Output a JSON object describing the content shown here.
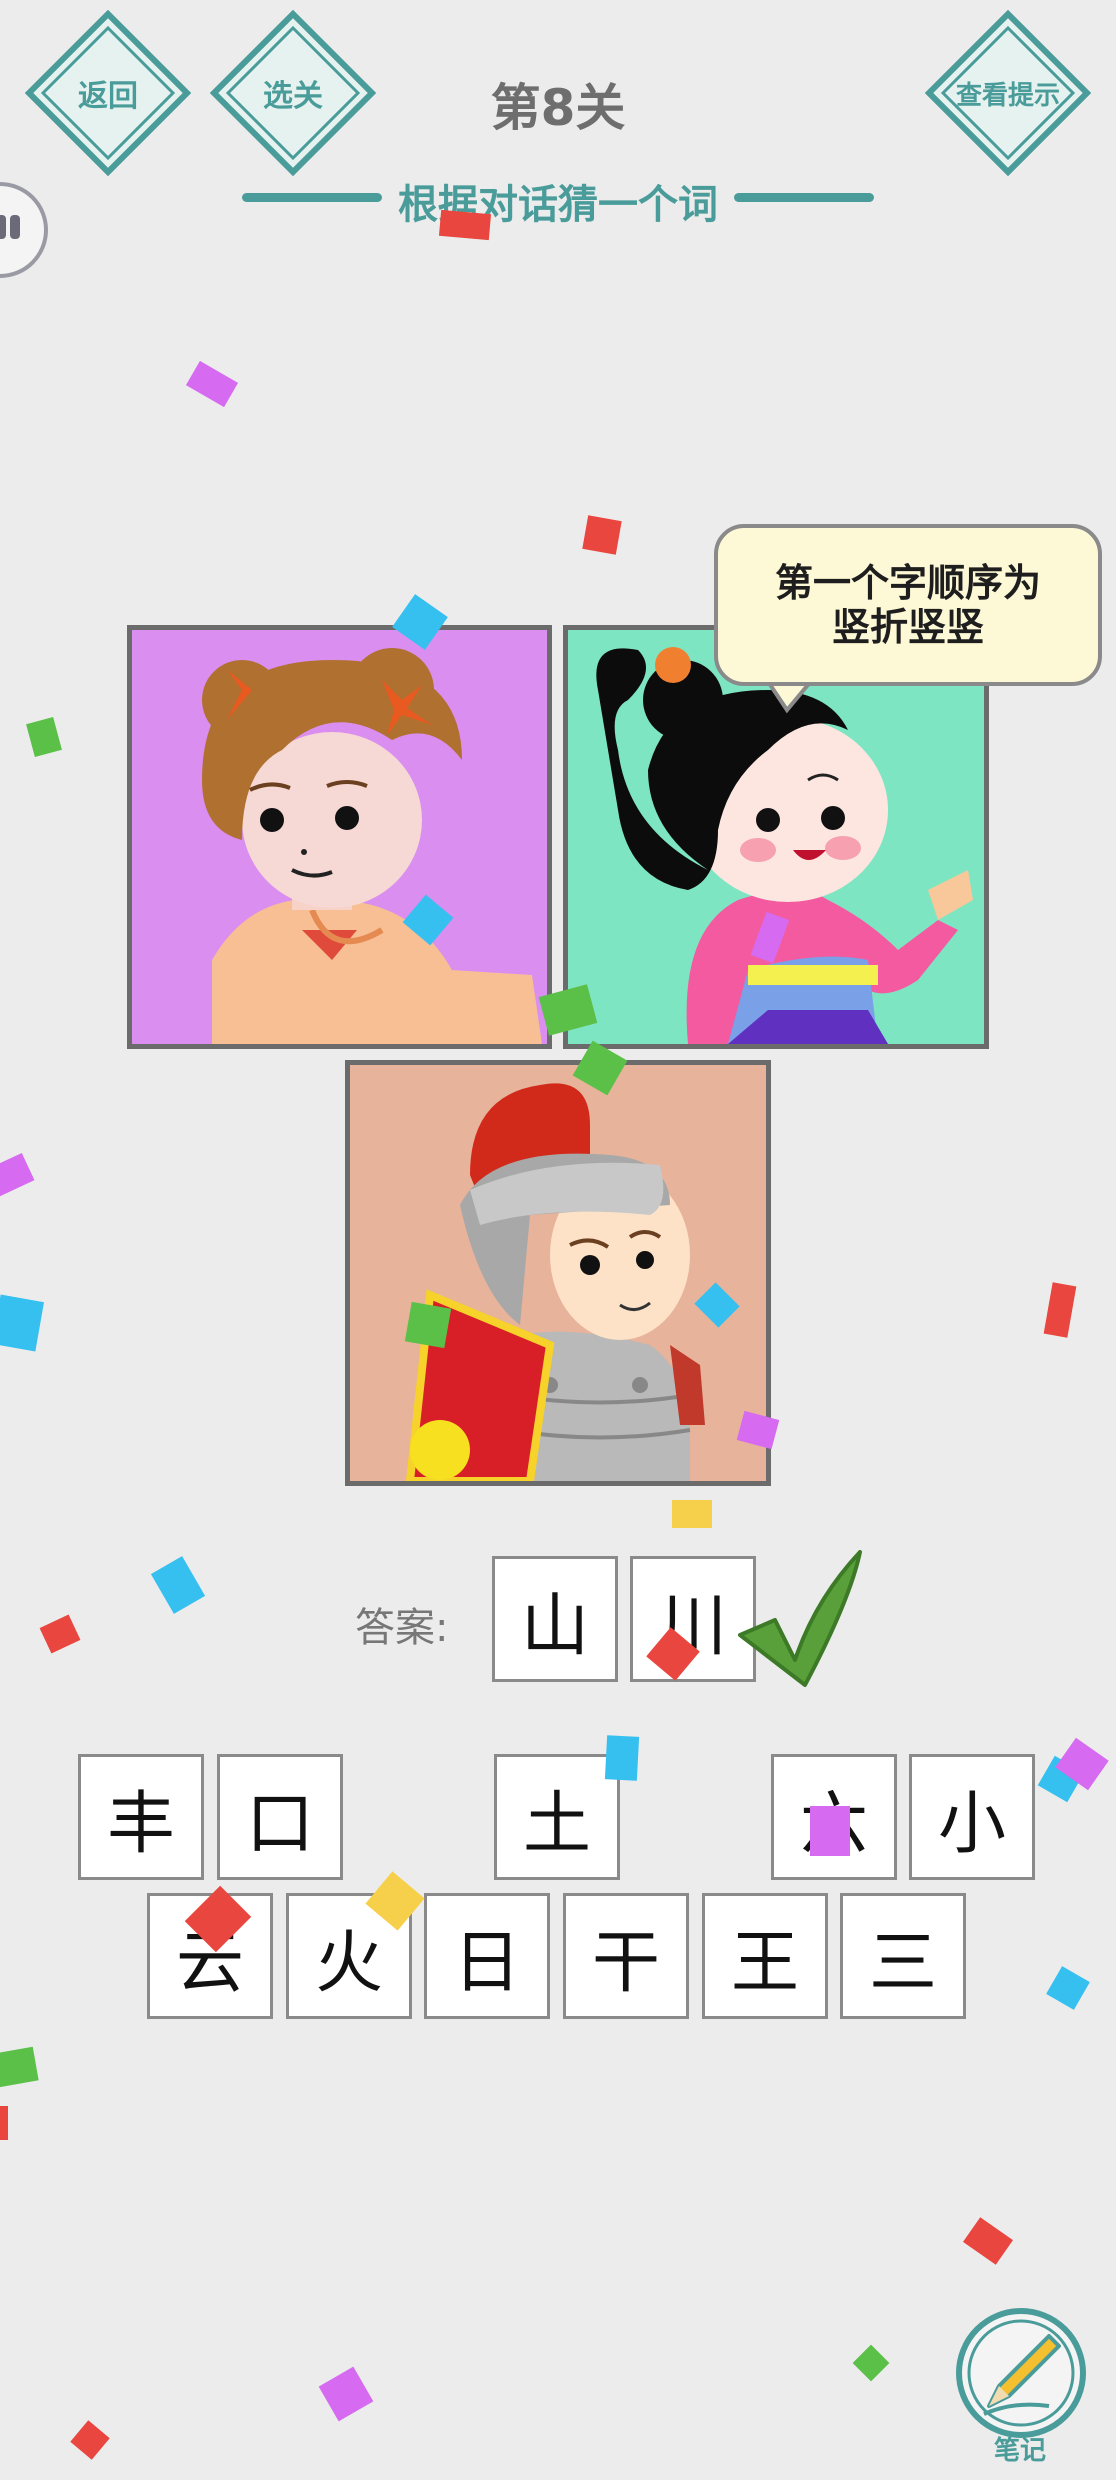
{
  "header": {
    "back_label": "返回",
    "select_label": "选关",
    "level_title": "第8关",
    "hint_label": "查看提示",
    "subtitle": "根据对话猜一个词"
  },
  "speech": {
    "line1": "第一个字顺序为",
    "line2": "竖折竖竖"
  },
  "answer": {
    "label": "答案:",
    "chars": [
      "山",
      "川"
    ]
  },
  "choices": {
    "row1": [
      "丰",
      "口",
      "土",
      "六",
      "小"
    ],
    "row2": [
      "云",
      "火",
      "日",
      "干",
      "王",
      "三"
    ]
  },
  "note": {
    "label": "笔记"
  },
  "colors": {
    "accent": "#4a9c9a",
    "correct": "#5aa03a"
  },
  "icons": [
    "back-diamond-icon",
    "checkmark-icon",
    "pencil-icon",
    "pause-icon"
  ]
}
